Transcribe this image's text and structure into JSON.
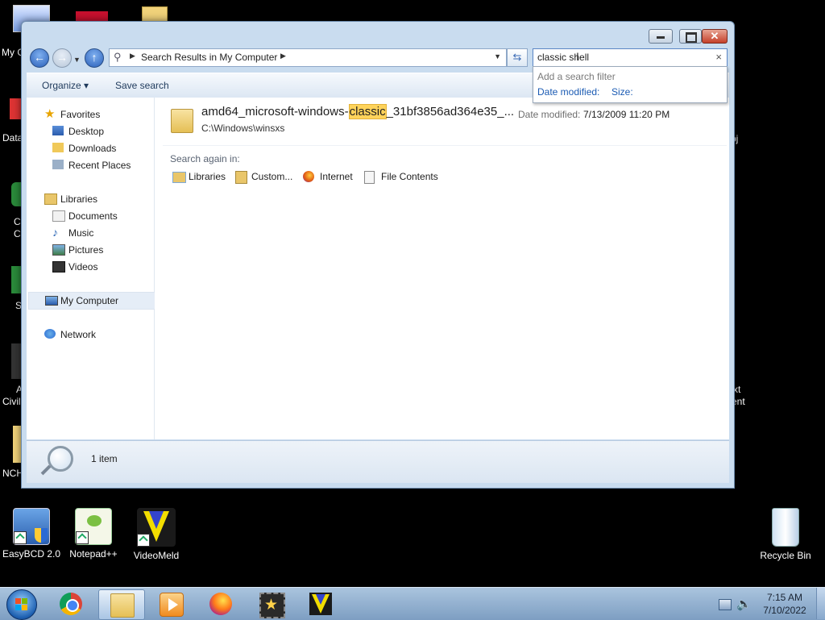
{
  "desktop": {
    "icons": [
      {
        "label": "EasyBCD 2.0",
        "icon": "easybcd-icon"
      },
      {
        "label": "Notepad++",
        "icon": "notepadpp-icon"
      },
      {
        "label": "VideoMeld",
        "icon": "videomeld-icon"
      },
      {
        "label": "Recycle Bin",
        "icon": "recycle-bin-icon"
      }
    ],
    "peek_labels": [
      "My C",
      "Data",
      "C",
      "C",
      "S",
      "A",
      "Civil",
      "NCH",
      "pj",
      "xt",
      "ent"
    ]
  },
  "window": {
    "address": {
      "items": [
        "Search Results in My Computer"
      ]
    },
    "search": {
      "value": "classic shell",
      "clear_icon": "×"
    },
    "search_dropdown": {
      "header": "Add a search filter",
      "filters": [
        "Date modified:",
        "Size:"
      ]
    },
    "toolbar": {
      "organize": "Organize",
      "save_search": "Save search"
    },
    "nav": {
      "favorites": {
        "label": "Favorites",
        "items": [
          "Desktop",
          "Downloads",
          "Recent Places"
        ]
      },
      "libraries": {
        "label": "Libraries",
        "items": [
          "Documents",
          "Music",
          "Pictures",
          "Videos"
        ]
      },
      "computer": "My Computer",
      "network": "Network"
    },
    "results": [
      {
        "name_before": "amd64_microsoft-windows-",
        "name_match": "classic",
        "name_after": "_31bf3856ad364e35_...",
        "path": "C:\\Windows\\winsxs",
        "date_label": "Date modified:",
        "date_value": "7/13/2009 11:20 PM"
      }
    ],
    "search_again": {
      "label": "Search again in:",
      "items": [
        "Libraries",
        "Custom...",
        "Internet",
        "File Contents"
      ]
    },
    "status": {
      "count": "1 item"
    }
  },
  "taskbar": {
    "clock_time": "7:15 AM",
    "clock_date": "7/10/2022",
    "items": [
      "start-orb-icon",
      "chrome-icon",
      "explorer-icon",
      "media-player-icon",
      "firefox-icon",
      "movie-maker-icon",
      "videomeld-icon"
    ]
  },
  "colors": {
    "highlight": "#ffd35b",
    "link": "#1b5bb3",
    "selection": "#e5edf7"
  }
}
